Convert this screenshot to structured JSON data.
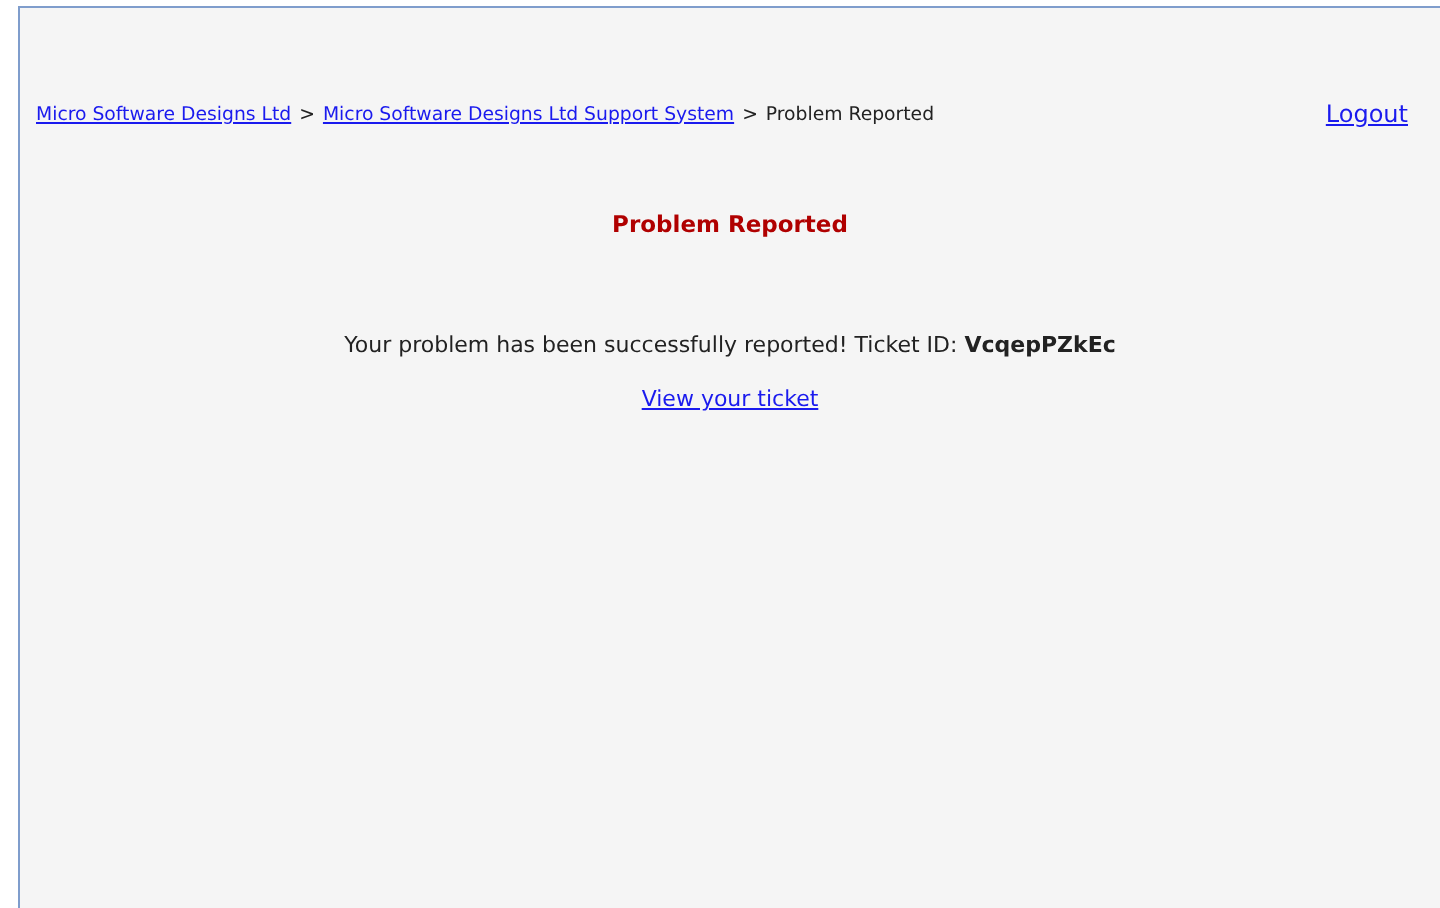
{
  "breadcrumb": {
    "items": [
      {
        "label": "Micro Software Designs Ltd",
        "kind": "link"
      },
      {
        "label": "Micro Software Designs Ltd Support System",
        "kind": "link"
      },
      {
        "label": "Problem Reported",
        "kind": "current"
      }
    ],
    "separator": ">"
  },
  "logout": "Logout",
  "heading": "Problem Reported",
  "message": "Your problem has been successfully reported! Ticket ID: **VcqepPZkEc**",
  "ticket_link": "View your ticket"
}
